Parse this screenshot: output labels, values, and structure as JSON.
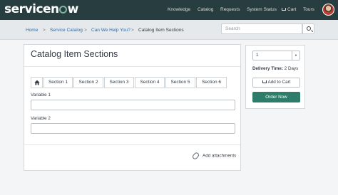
{
  "header": {
    "logo_pre": "servicen",
    "logo_post": "w",
    "nav": [
      {
        "label": "Knowledge"
      },
      {
        "label": "Catalog"
      },
      {
        "label": "Requests"
      },
      {
        "label": "System Status"
      },
      {
        "label": "Cart",
        "icon": "cart-icon"
      },
      {
        "label": "Tours"
      }
    ],
    "avatar": "user-avatar"
  },
  "breadcrumb": {
    "items": [
      "Home",
      "Service Catalog",
      "Can We Help You?",
      "Catalog Item Sections"
    ],
    "separator": ">"
  },
  "search": {
    "placeholder": "Search",
    "icon": "search-icon"
  },
  "item": {
    "title": "Catalog Item Sections",
    "tabs": [
      {
        "label": "Section 1"
      },
      {
        "label": "Section 2"
      },
      {
        "label": "Section 3"
      },
      {
        "label": "Section 4"
      },
      {
        "label": "Section 5"
      },
      {
        "label": "Section 6"
      }
    ],
    "fields": [
      {
        "label": "Variable 1",
        "value": ""
      },
      {
        "label": "Variable 2",
        "value": ""
      }
    ],
    "attachments_label": "Add attachments"
  },
  "order": {
    "quantity": "1",
    "delivery_label": "Delivery Time:",
    "delivery_value": "2 Days",
    "add_to_cart": "Add to Cart",
    "order_now": "Order Now"
  },
  "colors": {
    "header_bg": "#283d3f",
    "order_button": "#2e7d6b",
    "link": "#2b6cb0"
  }
}
